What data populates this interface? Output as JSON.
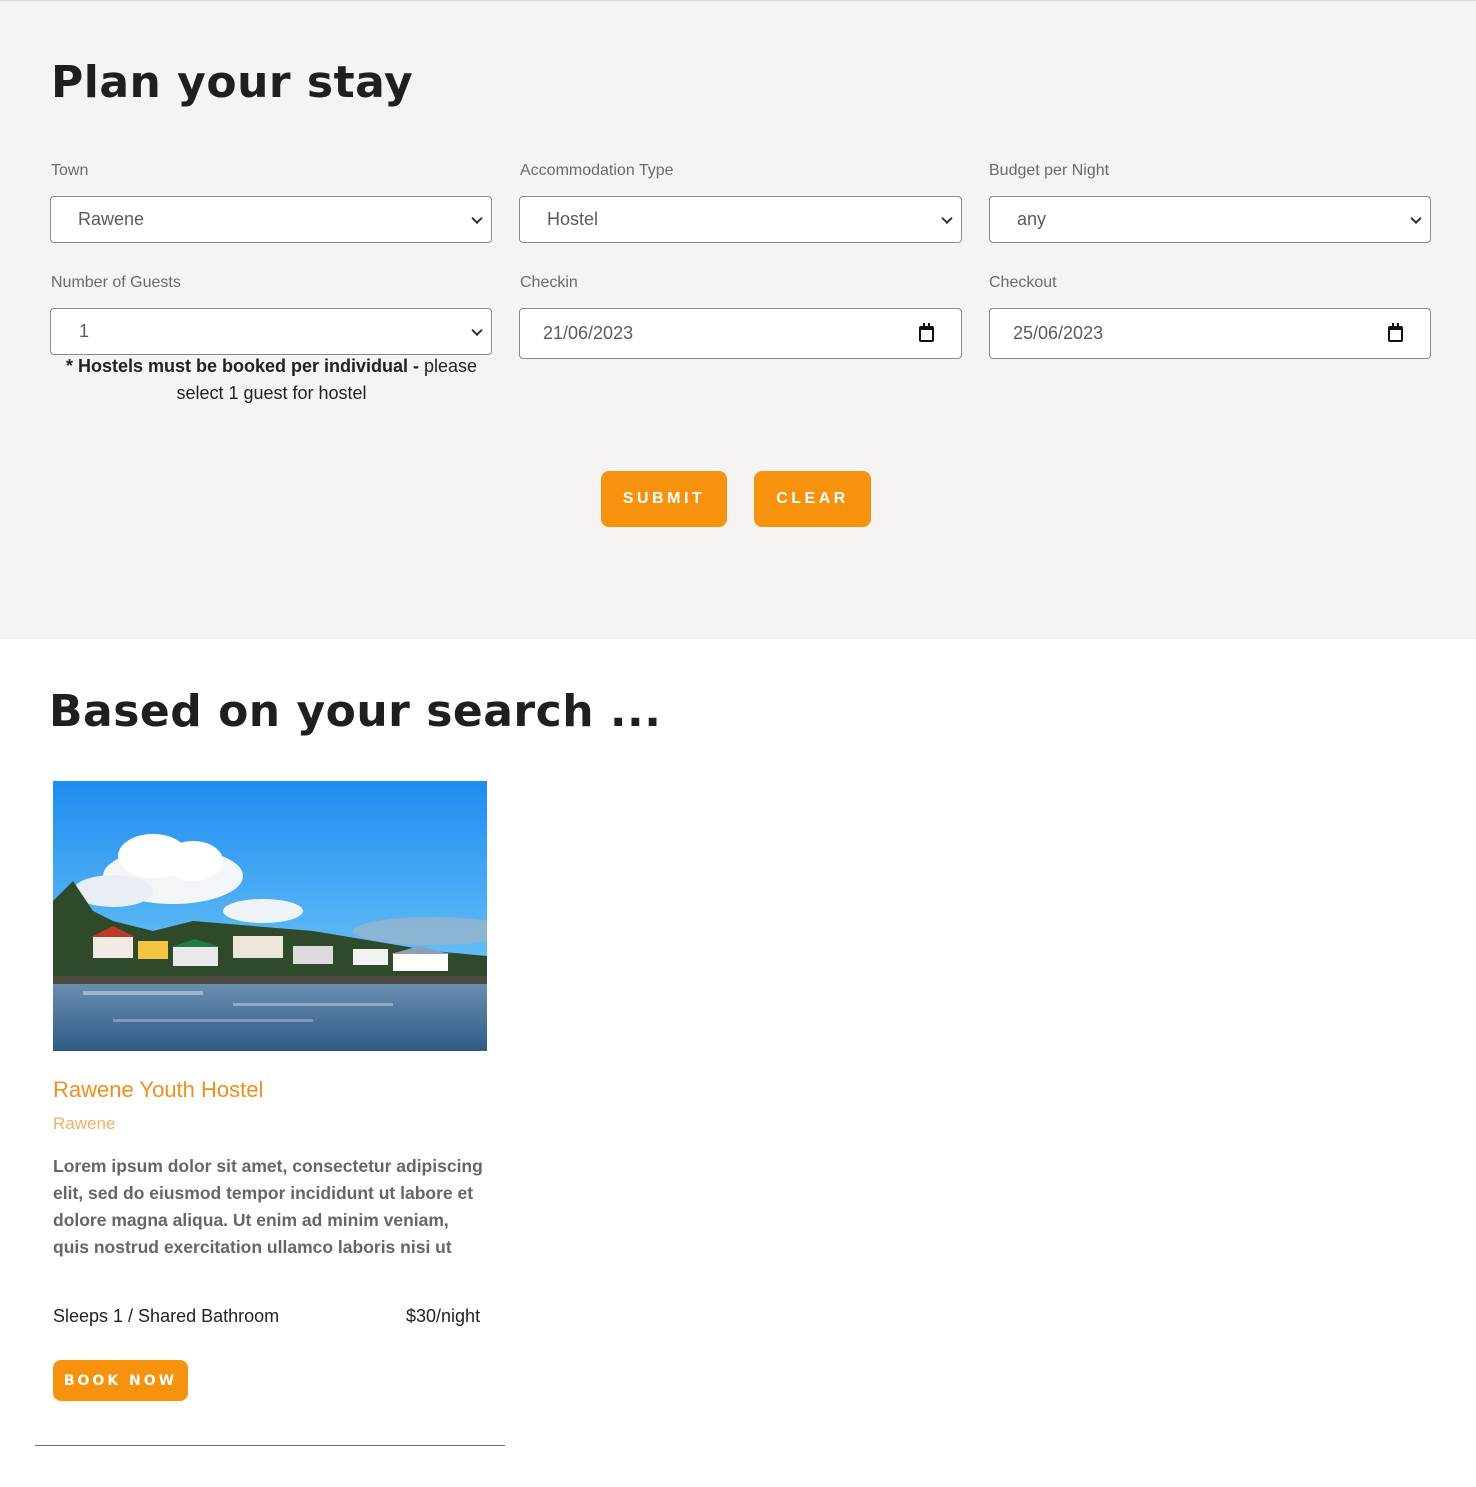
{
  "plan": {
    "title": "Plan your stay",
    "town": {
      "label": "Town",
      "value": "Rawene"
    },
    "accommodation": {
      "label": "Accommodation Type",
      "value": "Hostel"
    },
    "budget": {
      "label": "Budget per Night",
      "value": "any"
    },
    "guests": {
      "label": "Number of Guests",
      "value": "1"
    },
    "checkin": {
      "label": "Checkin",
      "value": "21/06/2023"
    },
    "checkout": {
      "label": "Checkout",
      "value": "25/06/2023"
    },
    "note_bold": "* Hostels must be booked per individual -",
    "note_rest": " please select 1 guest for hostel",
    "submit_label": "SUBMIT",
    "clear_label": "CLEAR"
  },
  "results": {
    "title": "Based on your search ...",
    "cards": [
      {
        "name": "Rawene Youth Hostel",
        "town": "Rawene",
        "description": "Lorem ipsum dolor sit amet, consectetur adipiscing elit, sed do eiusmod tempor incididunt ut labore et dolore magna aliqua. Ut enim ad minim veniam, quis nostrud exercitation ullamco laboris nisi ut",
        "sleeps": "Sleeps 1 / Shared Bathroom",
        "price": "$30/night",
        "book_label": "BOOK NOW"
      }
    ]
  },
  "colors": {
    "accent": "#f7920f",
    "card_title": "#ef8f1c",
    "card_town": "#f3b062",
    "section_bg": "#f5f4f2"
  },
  "icons": [
    "chevron-down-icon",
    "calendar-icon"
  ]
}
